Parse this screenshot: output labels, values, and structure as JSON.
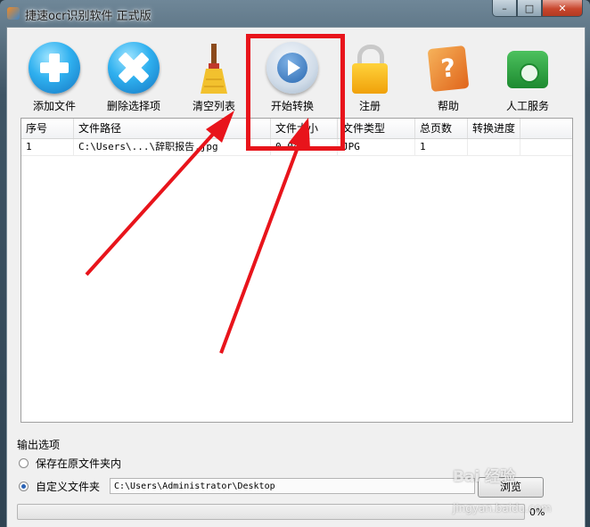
{
  "window": {
    "title": "捷速ocr识别软件 正式版",
    "controls": {
      "minimize": "–",
      "maximize": "□",
      "close": "✕"
    }
  },
  "toolbar": {
    "items": [
      {
        "label": "添加文件",
        "icon": "add-circle-icon"
      },
      {
        "label": "删除选择项",
        "icon": "delete-circle-icon"
      },
      {
        "label": "清空列表",
        "icon": "broom-icon"
      },
      {
        "label": "开始转换",
        "icon": "play-icon"
      },
      {
        "label": "注册",
        "icon": "lock-icon"
      },
      {
        "label": "帮助",
        "icon": "help-book-icon"
      },
      {
        "label": "人工服务",
        "icon": "phone-icon"
      }
    ]
  },
  "file_list": {
    "columns": [
      "序号",
      "文件路径",
      "文件大小",
      "文件类型",
      "总页数",
      "转换进度"
    ],
    "rows": [
      [
        "1",
        "C:\\Users\\...\\辞职报告.jpg",
        "0.04M",
        "JPG",
        "1",
        ""
      ]
    ]
  },
  "output_options": {
    "title": "输出选项",
    "option_original": "保存在原文件夹内",
    "option_custom": "自定义文件夹",
    "selected": "custom",
    "path_value": "C:\\Users\\Administrator\\Desktop",
    "browse_label": "浏览"
  },
  "progress": {
    "value": 0,
    "label": "0%",
    "fill_color": "#3cb043"
  },
  "annotation": {
    "highlight_color": "#e8141b"
  },
  "watermark": {
    "brand": "Bai 经验",
    "site": "jingyan.baidu.com"
  }
}
